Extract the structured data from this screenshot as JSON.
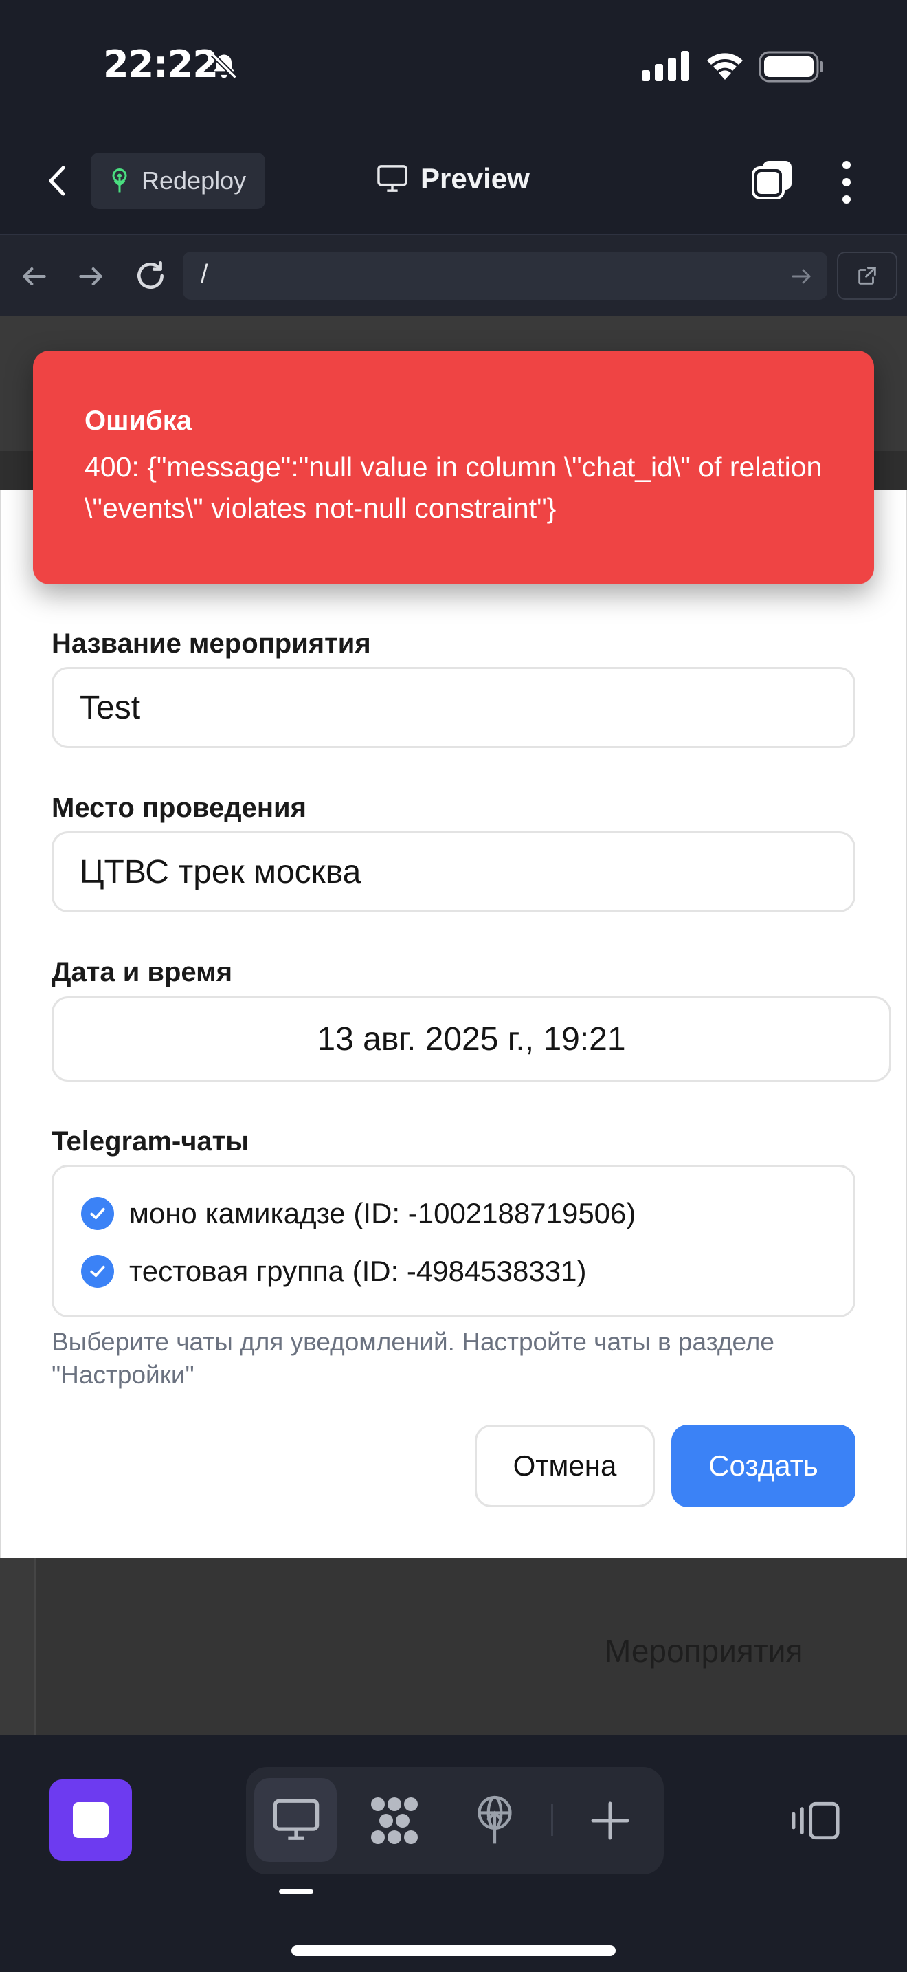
{
  "status_bar": {
    "time": "22:22"
  },
  "header": {
    "redeploy_label": "Redeploy",
    "preview_label": "Preview"
  },
  "browser": {
    "url": "/"
  },
  "toast": {
    "title": "Ошибка",
    "message": "400: {\"message\":\"null value in column \\\"chat_id\\\" of relation \\\"events\\\" violates not-null constraint\"}"
  },
  "form": {
    "name_label": "Название мероприятия",
    "name_value": "Test",
    "place_label": "Место проведения",
    "place_value": "ЦТВС трек москва",
    "date_label": "Дата и время",
    "date_value": "13 авг. 2025 г., 19:21",
    "chats_label": "Telegram-чаты",
    "chats": [
      {
        "label": "моно камикадзе (ID: -1002188719506)",
        "checked": true
      },
      {
        "label": "тестовая группа (ID: -4984538331)",
        "checked": true
      }
    ],
    "chats_hint": "Выберите чаты для уведомлений. Настройте чаты в разделе \"Настройки\"",
    "cancel_label": "Отмена",
    "create_label": "Создать"
  },
  "background_page": {
    "visible_text": "Мероприятия"
  },
  "colors": {
    "error": "#ef4444",
    "primary": "#3b82f6",
    "stop_button": "#6d3bf0",
    "chrome_bg": "#1b1e28"
  }
}
